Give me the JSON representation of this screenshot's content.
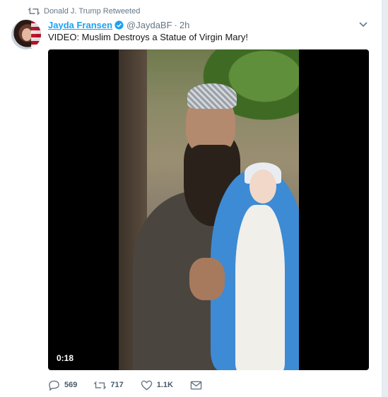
{
  "retweet_context": {
    "text": "Donald J. Trump Retweeted"
  },
  "tweet": {
    "author_name": "Jayda Fransen",
    "handle": "@JaydaBF",
    "separator": "·",
    "time": "2h",
    "text": "VIDEO: Muslim Destroys a Statue of Virgin Mary!"
  },
  "media": {
    "duration": "0:18"
  },
  "actions": {
    "reply_count": "569",
    "retweet_count": "717",
    "like_count": "1.1K"
  },
  "colors": {
    "link_blue": "#1da1f2",
    "muted_gray": "#657786",
    "background": "#e6ecf0"
  },
  "icons": [
    "retweet-icon",
    "verified-icon",
    "chevron-down-icon",
    "reply-icon",
    "like-icon",
    "message-icon"
  ]
}
